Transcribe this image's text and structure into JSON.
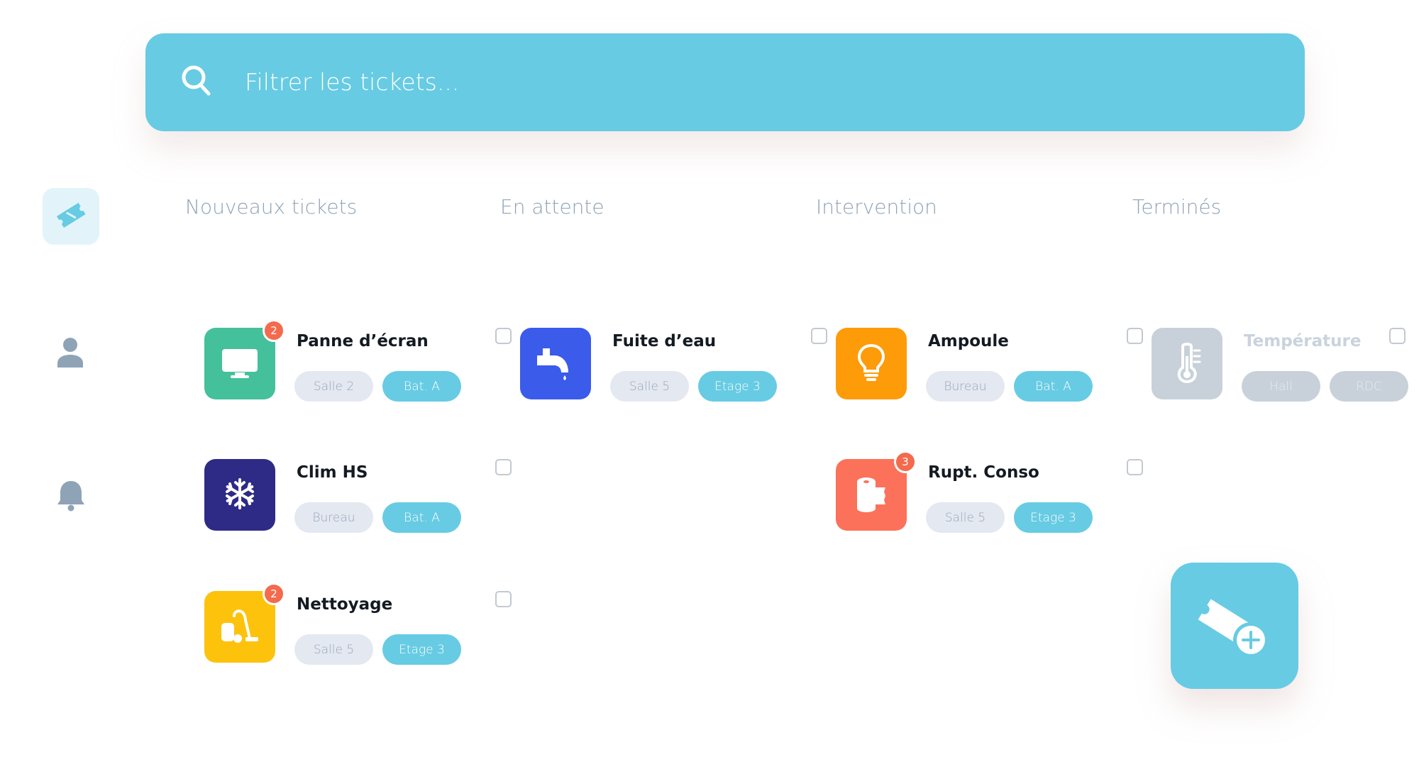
{
  "search": {
    "placeholder": "Filtrer les tickets..."
  },
  "columns": [
    "Nouveaux tickets",
    "En attente",
    "Intervention",
    "Terminés"
  ],
  "tickets": [
    {
      "title": "Panne d’écran",
      "place": "Salle 2",
      "zone": "Bat. A",
      "badge": "2",
      "icon": "monitor-icon",
      "color": "#44c09a",
      "column": "Nouveaux tickets"
    },
    {
      "title": "Clim HS",
      "place": "Bureau",
      "zone": "Bat. A",
      "badge": "",
      "icon": "snowflake-icon",
      "color": "#2e2b86",
      "column": "Nouveaux tickets"
    },
    {
      "title": "Nettoyage",
      "place": "Salle 5",
      "zone": "Etage 3",
      "badge": "2",
      "icon": "vacuum-cleaner-icon",
      "color": "#fdc20c",
      "column": "Nouveaux tickets"
    },
    {
      "title": "Fuite d’eau",
      "place": "Salle 5",
      "zone": "Etage 3",
      "badge": "",
      "icon": "water-tap-icon",
      "color": "#3b5bea",
      "column": "En attente"
    },
    {
      "title": "Ampoule",
      "place": "Bureau",
      "zone": "Bat. A",
      "badge": "",
      "icon": "lightbulb-icon",
      "color": "#fd9b08",
      "column": "Intervention"
    },
    {
      "title": "Rupt. Conso",
      "place": "Salle 5",
      "zone": "Etage 3",
      "badge": "3",
      "icon": "toilet-paper-icon",
      "color": "#fc7159",
      "column": "Intervention"
    },
    {
      "title": "Température",
      "place": "Hall",
      "zone": "RDC",
      "badge": "",
      "icon": "thermometer-icon",
      "color": "#c8d1d9",
      "column": "Terminés"
    }
  ],
  "colors": {
    "accent": "#67cbe3",
    "badge": "#f46a4e",
    "tag_place_bg": "#e3e8f1",
    "column_title": "#8fa3b7"
  },
  "sidebar": {
    "items": [
      "ticket-icon",
      "user-icon",
      "bell-icon"
    ]
  },
  "fab": {
    "icon": "add-ticket-icon"
  }
}
